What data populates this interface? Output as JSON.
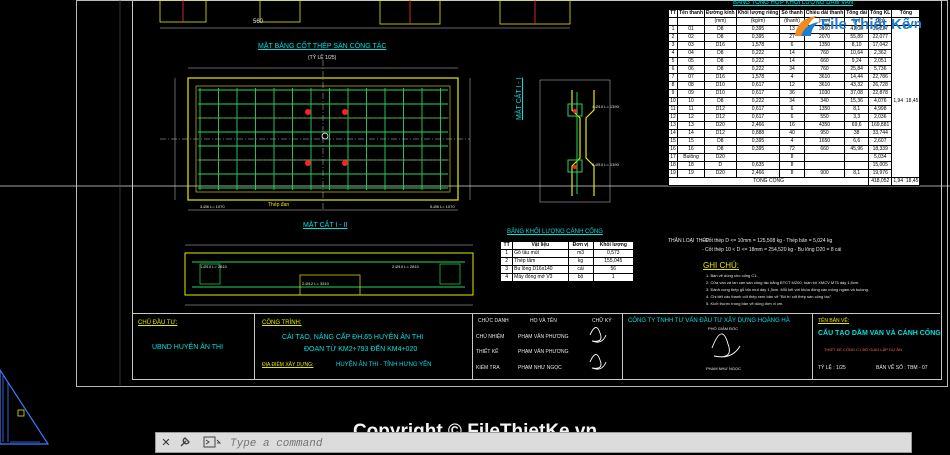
{
  "drawing": {
    "plan_title": "MẶT BẰNG CỐT THÉP SÀN CÔNG TÁC",
    "plan_scale": "(TỶ LỆ 1/25)",
    "section_title": "MẶT CẮT I - II",
    "side_title": "MẶT CẮT I - I",
    "top_dim": "560",
    "note_bar": "Thép đan",
    "rebar_labels": [
      "1-Ø10 L= 2610",
      "2-Ø10 L= 2810",
      "2-Ø12 L= 3310",
      "3-Ø8 L= 1070",
      "5-Ø8 L= 1070",
      "4-Ø10 L= 1390",
      "5-Ø10 L= 1390"
    ]
  },
  "summary_table": {
    "title": "BẢNG TỔNG HỢP KHỐI LƯỢNG DẦM VAN",
    "headers": [
      "TT",
      "Tên thanh",
      "Đường kính",
      "Khối lượng riêng",
      "Số thanh",
      "Chiều dài thanh",
      "Tổng dài",
      "Tổng KL",
      "Tổng"
    ],
    "units": [
      "",
      "",
      "(mm)",
      "(kg/m)",
      "(thanh)",
      "(mm)",
      "(m)",
      "(kg)",
      ""
    ],
    "rows": [
      [
        "1",
        "01",
        "D8",
        "0,395",
        "13",
        "3160",
        "41,08",
        "16,227"
      ],
      [
        "2",
        "02",
        "D8",
        "0,395",
        "27",
        "2070",
        "55,89",
        "22,077"
      ],
      [
        "3",
        "03",
        "D16",
        "1,578",
        "6",
        "1350",
        "8,10",
        "17,042"
      ],
      [
        "4",
        "04",
        "D8",
        "0,222",
        "14",
        "760",
        "10,64",
        "2,362"
      ],
      [
        "5",
        "05",
        "D8",
        "0,222",
        "14",
        "660",
        "9,24",
        "2,051"
      ],
      [
        "6",
        "06",
        "D8",
        "0,222",
        "34",
        "760",
        "25,84",
        "5,736"
      ],
      [
        "7",
        "07",
        "D16",
        "1,578",
        "4",
        "3610",
        "14,44",
        "22,786"
      ],
      [
        "8",
        "08",
        "D10",
        "0,617",
        "12",
        "3610",
        "43,32",
        "26,728"
      ],
      [
        "9",
        "09",
        "D10",
        "0,617",
        "36",
        "1030",
        "37,08",
        "22,878"
      ],
      [
        "10",
        "10",
        "D8",
        "0,222",
        "34",
        "340",
        "15,36",
        "4,076"
      ],
      [
        "11",
        "11",
        "D12",
        "0,617",
        "6",
        "1350",
        "8,1",
        "4,998"
      ],
      [
        "12",
        "12",
        "D12",
        "0,617",
        "6",
        "550",
        "3,3",
        "2,036"
      ],
      [
        "13",
        "13",
        "D20",
        "2,466",
        "16",
        "4350",
        "69,6",
        "169,881"
      ],
      [
        "14",
        "14",
        "D12",
        "0,888",
        "40",
        "950",
        "38",
        "33,744"
      ],
      [
        "15",
        "15",
        "D8",
        "0,395",
        "4",
        "1650",
        "6,6",
        "2,607"
      ],
      [
        "16",
        "16",
        "D8",
        "0,395",
        "72",
        "660",
        "45,96",
        "18,339"
      ],
      [
        "17",
        "Bulông",
        "D20",
        "",
        "8",
        "",
        "",
        "5,034"
      ],
      [
        "18",
        "18",
        "D",
        "0,635",
        "8",
        "",
        "",
        "15,005"
      ],
      [
        "19",
        "19",
        "D20",
        "2,466",
        "8",
        "900",
        "8,1",
        "19,976"
      ]
    ],
    "merged_total_a": "1,94",
    "merged_total_b": "18,45",
    "total_label": "TỔNG CỘNG",
    "total_values": [
      "418,052",
      "1,94",
      "18,45"
    ],
    "summary_lines": [
      "- Cốt thép D <= 10mm   =  125,508 kg    - Thép bản   =  5,024 kg",
      "- Cốt thép 10 < D <= 18mm = 254,520 kg  - Bu lông D20 =  8 cái"
    ],
    "summary_label": "THÂN LOẠI THÉP"
  },
  "gate_table": {
    "title": "BẢNG KHỐI LƯỢNG CÁNH CỐNG",
    "headers": [
      "TT",
      "Vật liệu",
      "Đơn vị",
      "Khối lượng"
    ],
    "rows": [
      [
        "1",
        "Gỗ tấu mút",
        "m3",
        "0,573"
      ],
      [
        "2",
        "Thép tấm",
        "kg",
        "155,045"
      ],
      [
        "3",
        "Bu lông D16x140",
        "cái",
        "56"
      ],
      [
        "4",
        "Máy đóng mở V3",
        "bộ",
        "1"
      ]
    ]
  },
  "notes": {
    "title": "GHI CHÚ:",
    "lines": [
      "1. Bản vẽ dùng cho cống C1.",
      "2. Cửa van và lan can sàn công tác bằng BTCT M200, toàn bộ XMCV M75 dày 1,5cm.",
      "3. Đánh cong thép gỗ tấu mút dày 1,5cm. Mỗi kết với khóa đóng các mộng ngàm và bulong.",
      "4. Chi tiết các thanh cốt thép xem bản vẽ \"Bố trí cốt thép sàn công tác\".",
      "5. Kích thước trong bản vẽ dùng đơn vị cm."
    ]
  },
  "title_block": {
    "owner_label": "CHỦ ĐẦU TƯ:",
    "owner": "UBND HUYỆN ÂN THI",
    "project_label": "CÔNG TRÌNH:",
    "project_line1": "CẢI TẠO, NÂNG CẤP ĐH.65 HUYỆN ÂN THI",
    "project_line2": "ĐOẠN TỪ KM2+793 ĐẾN KM4+020",
    "location_label": "ĐỊA ĐIỂM XÂY DỰNG:",
    "location": "HUYỆN ÂN THI - TỈNH HƯNG YÊN",
    "roles": [
      "CHỦ TRÌ",
      "CHỦ NHIỆM",
      "THIẾT KẾ",
      "KIỂM TRA"
    ],
    "role_header": "CHỨC DANH",
    "name_header": "HỌ VÀ TÊN",
    "sign_header": "CHỮ KÝ",
    "names": [
      "PHẠM VĂN PHƯƠNG",
      "PHẠM VĂN PHƯƠNG",
      "PHẠM VĂN PHƯƠNG",
      "PHẠM NHƯ NGỌC"
    ],
    "company": "CÔNG TY TNHH TƯ VẤN ĐẦU TƯ XÂY DỰNG HOÀNG HÀ",
    "director_label": "PHÓ GIÁM ĐỐC",
    "director_name": "PHẠM NHƯ NGỌC",
    "sheet_label": "TÊN BẢN VẼ:",
    "sheet_title": "CẤU TẠO DẦM VAN VÀ CÁNH CỐNG",
    "sheet_sub": "THIẾT KẾ CỐNG C1 BỐ GIAO LẬP DỰ ÁN",
    "scale_label": "TỶ LỆ : 1/25",
    "sheet_no": "BẢN VẼ SỐ : TBM - 07"
  },
  "command_bar": {
    "placeholder": "Type a command",
    "close_icon": "close-icon",
    "tool_icon": "wrench-icon",
    "prompt_icon": "command-prompt-icon"
  },
  "watermark": "Copyright © FileThietKe.vn",
  "logo": {
    "brand": "File Thiết Kế",
    "domain": ".vn"
  },
  "colors": {
    "background": "#000000",
    "cad_green": "#22d85a",
    "cad_yellow": "#e8e800",
    "cad_cyan": "#00e0e0",
    "cad_red": "#ff2020",
    "logo_blue": "#1e7fd0",
    "logo_orange": "#f28a1e"
  }
}
